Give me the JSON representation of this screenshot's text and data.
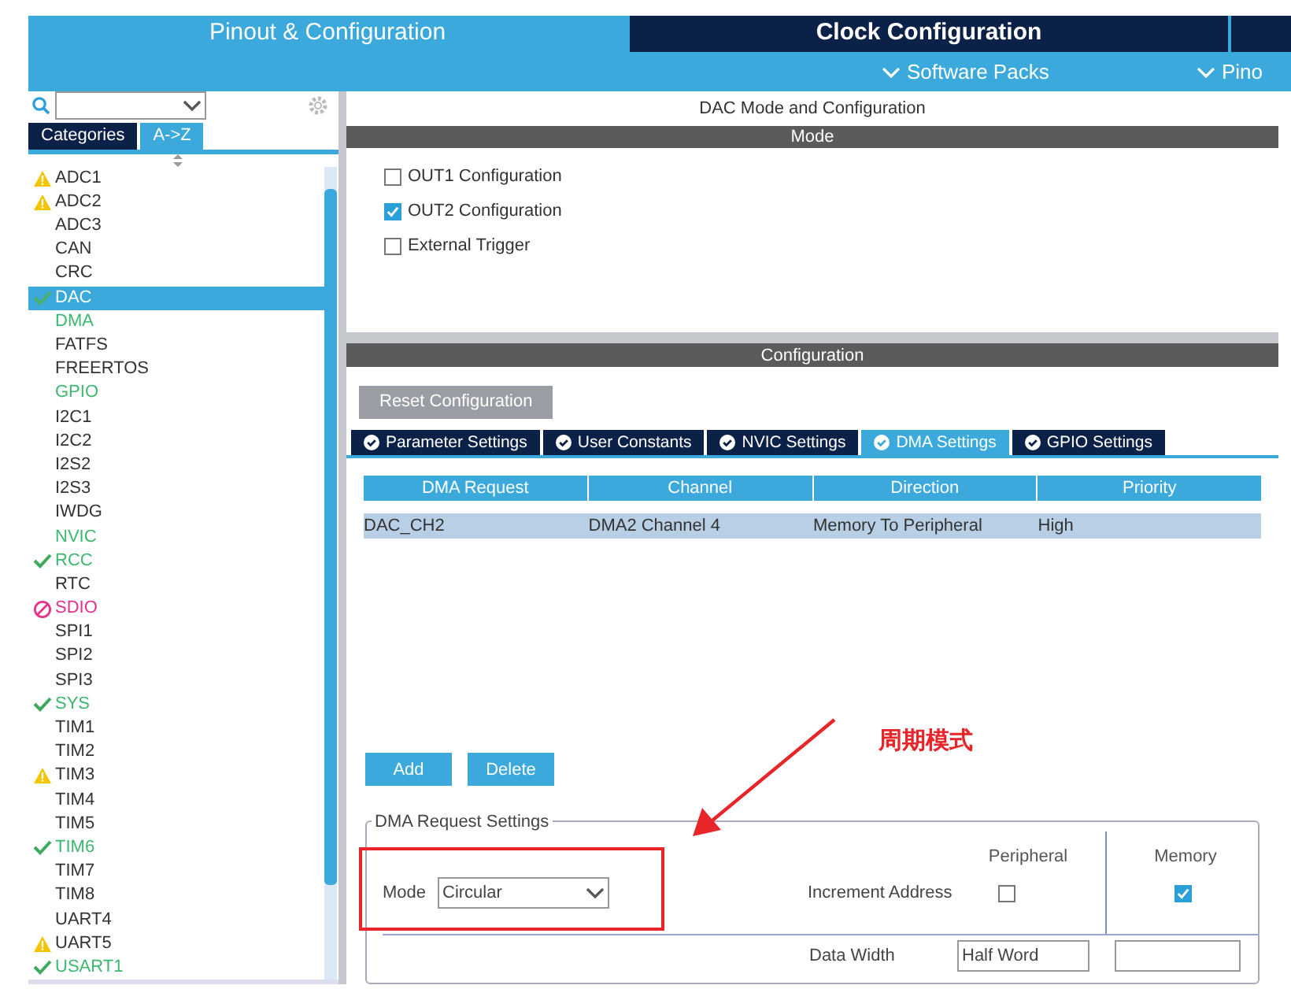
{
  "top_tabs": [
    {
      "label": "Pinout & Configuration",
      "selected": true
    },
    {
      "label": "Clock Configuration",
      "selected": false
    }
  ],
  "sub_menus": [
    "Software Packs",
    "Pino"
  ],
  "sidebar": {
    "tabs": [
      {
        "label": "Categories",
        "selected": false
      },
      {
        "label": "A->Z",
        "selected": true
      }
    ],
    "items": [
      {
        "label": "ADC1",
        "kind": "warning",
        "configured": false,
        "selected": false
      },
      {
        "label": "ADC2",
        "kind": "warning",
        "configured": false,
        "selected": false
      },
      {
        "label": "ADC3",
        "kind": "plain",
        "configured": false,
        "selected": false
      },
      {
        "label": "CAN",
        "kind": "plain",
        "configured": false,
        "selected": false
      },
      {
        "label": "CRC",
        "kind": "plain",
        "configured": false,
        "selected": false
      },
      {
        "label": "DAC",
        "kind": "ok",
        "configured": true,
        "selected": true
      },
      {
        "label": "DMA",
        "kind": "plain",
        "configured": true,
        "selected": false
      },
      {
        "label": "FATFS",
        "kind": "plain",
        "configured": false,
        "selected": false
      },
      {
        "label": "FREERTOS",
        "kind": "plain",
        "configured": false,
        "selected": false
      },
      {
        "label": "GPIO",
        "kind": "plain",
        "configured": true,
        "selected": false
      },
      {
        "label": "I2C1",
        "kind": "plain",
        "configured": false,
        "selected": false
      },
      {
        "label": "I2C2",
        "kind": "plain",
        "configured": false,
        "selected": false
      },
      {
        "label": "I2S2",
        "kind": "plain",
        "configured": false,
        "selected": false
      },
      {
        "label": "I2S3",
        "kind": "plain",
        "configured": false,
        "selected": false
      },
      {
        "label": "IWDG",
        "kind": "plain",
        "configured": false,
        "selected": false
      },
      {
        "label": "NVIC",
        "kind": "plain",
        "configured": true,
        "selected": false
      },
      {
        "label": "RCC",
        "kind": "ok",
        "configured": true,
        "selected": false
      },
      {
        "label": "RTC",
        "kind": "plain",
        "configured": false,
        "selected": false
      },
      {
        "label": "SDIO",
        "kind": "blocked",
        "configured": false,
        "selected": false
      },
      {
        "label": "SPI1",
        "kind": "plain",
        "configured": false,
        "selected": false
      },
      {
        "label": "SPI2",
        "kind": "plain",
        "configured": false,
        "selected": false
      },
      {
        "label": "SPI3",
        "kind": "plain",
        "configured": false,
        "selected": false
      },
      {
        "label": "SYS",
        "kind": "ok",
        "configured": true,
        "selected": false
      },
      {
        "label": "TIM1",
        "kind": "plain",
        "configured": false,
        "selected": false
      },
      {
        "label": "TIM2",
        "kind": "plain",
        "configured": false,
        "selected": false
      },
      {
        "label": "TIM3",
        "kind": "warning",
        "configured": false,
        "selected": false
      },
      {
        "label": "TIM4",
        "kind": "plain",
        "configured": false,
        "selected": false
      },
      {
        "label": "TIM5",
        "kind": "plain",
        "configured": false,
        "selected": false
      },
      {
        "label": "TIM6",
        "kind": "ok",
        "configured": true,
        "selected": false
      },
      {
        "label": "TIM7",
        "kind": "plain",
        "configured": false,
        "selected": false
      },
      {
        "label": "TIM8",
        "kind": "plain",
        "configured": false,
        "selected": false
      },
      {
        "label": "UART4",
        "kind": "plain",
        "configured": false,
        "selected": false
      },
      {
        "label": "UART5",
        "kind": "warning",
        "configured": false,
        "selected": false
      },
      {
        "label": "USART1",
        "kind": "ok",
        "configured": true,
        "selected": false
      }
    ]
  },
  "panel_title": "DAC Mode and Configuration",
  "mode": {
    "header": "Mode",
    "options": [
      {
        "label": "OUT1 Configuration",
        "checked": false
      },
      {
        "label": "OUT2 Configuration",
        "checked": true
      },
      {
        "label": "External Trigger",
        "checked": false
      }
    ]
  },
  "configuration": {
    "header": "Configuration",
    "reset_button": "Reset Configuration",
    "tabs": [
      {
        "label": "Parameter Settings",
        "selected": false
      },
      {
        "label": "User Constants",
        "selected": false
      },
      {
        "label": "NVIC Settings",
        "selected": false
      },
      {
        "label": "DMA Settings",
        "selected": true
      },
      {
        "label": "GPIO Settings",
        "selected": false
      }
    ],
    "table": {
      "columns": [
        "DMA Request",
        "Channel",
        "Direction",
        "Priority"
      ],
      "rows": [
        {
          "cells": [
            "DAC_CH2",
            "DMA2 Channel 4",
            "Memory To Peripheral",
            "High"
          ],
          "selected": true
        }
      ]
    },
    "buttons": [
      "Add",
      "Delete"
    ],
    "request_settings": {
      "legend": "DMA Request Settings",
      "mode_label": "Mode",
      "mode_value": "Circular",
      "col_peripheral": "Peripheral",
      "col_memory": "Memory",
      "increment_label": "Increment Address",
      "peripheral_increment": false,
      "memory_increment": true,
      "data_width_label": "Data Width",
      "peripheral_width": "Half Word"
    }
  },
  "annotation": {
    "text": "周期模式"
  }
}
